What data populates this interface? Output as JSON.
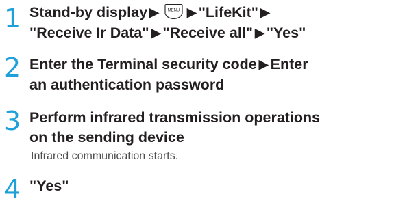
{
  "steps": [
    {
      "number": "1",
      "line1": {
        "part1": "Stand-by display",
        "arrow1": "▶",
        "menu_key_label": "MENU",
        "arrow2": "▶",
        "part2": "\"LifeKit\"",
        "arrow3": "▶"
      },
      "line2": {
        "part1": "\"Receive Ir Data\"",
        "arrow1": "▶",
        "part2": "\"Receive all\"",
        "arrow2": "▶",
        "part3": "\"Yes\""
      }
    },
    {
      "number": "2",
      "line1": {
        "part1": "Enter the Terminal security code",
        "arrow1": "▶",
        "part2": "Enter"
      },
      "line2": "an authentication password"
    },
    {
      "number": "3",
      "line1": "Perform infrared transmission operations",
      "line2": "on the sending device",
      "note": "Infrared communication starts."
    },
    {
      "number": "4",
      "line1": "\"Yes\""
    }
  ],
  "colors": {
    "step_number": "#1ea1d9",
    "text": "#231f20",
    "note": "#4d4d4d"
  },
  "icons": {
    "menu_key": "menu-key-icon"
  }
}
